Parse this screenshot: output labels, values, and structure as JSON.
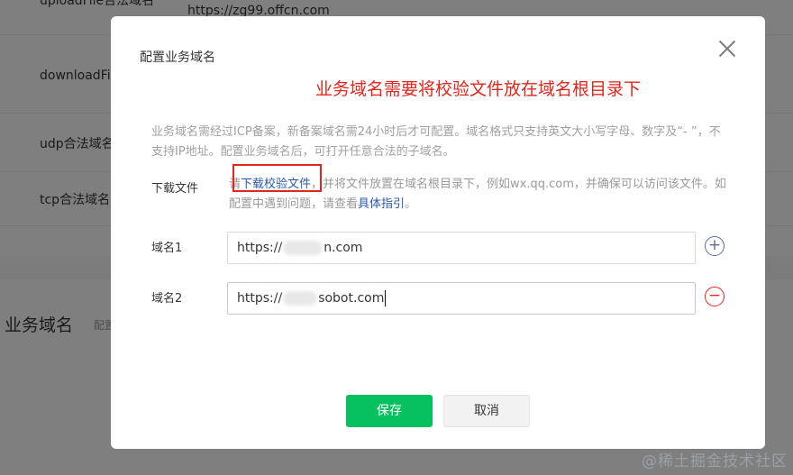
{
  "background": {
    "rows": [
      {
        "label": "uploadFile合法域名",
        "value": "https://zg99.offcn.com"
      },
      {
        "label": "downloadFi",
        "value": ""
      },
      {
        "label": "udp合法域名",
        "value": ""
      },
      {
        "label": "tcp合法域名",
        "value": ""
      }
    ],
    "section_title": "业务域名",
    "section_sub": "配置"
  },
  "dialog": {
    "title": "配置业务域名",
    "annotation": "业务域名需要将校验文件放在域名根目录下",
    "description": "业务域名需经过ICP备案，新备案域名需24小时后才可配置。域名格式只支持英文大小写字母、数字及“- ”，不支持IP地址。配置业务域名后，可打开任意合法的子域名。",
    "download": {
      "label": "下载文件",
      "prefix": "请",
      "link": "下载校验文件",
      "middle": "，并将文件放置在域名根目录下，例如wx.qq.com，并确保可以访问该文件。如配置中遇到问题，请查看",
      "guide_link": "具体指引",
      "suffix": "。"
    },
    "domains": [
      {
        "label": "域名1",
        "prefix": "https://",
        "suffix": "n.com"
      },
      {
        "label": "域名2",
        "prefix": "https://",
        "suffix": "sobot.com"
      }
    ],
    "add_symbol": "+",
    "remove_symbol": "−",
    "save_label": "保存",
    "cancel_label": "取消"
  },
  "watermark": "@稀土掘金技术社区",
  "colors": {
    "primary_green": "#07c160",
    "annotation_red": "#e0261d",
    "link_blue": "#2b5aa8"
  }
}
